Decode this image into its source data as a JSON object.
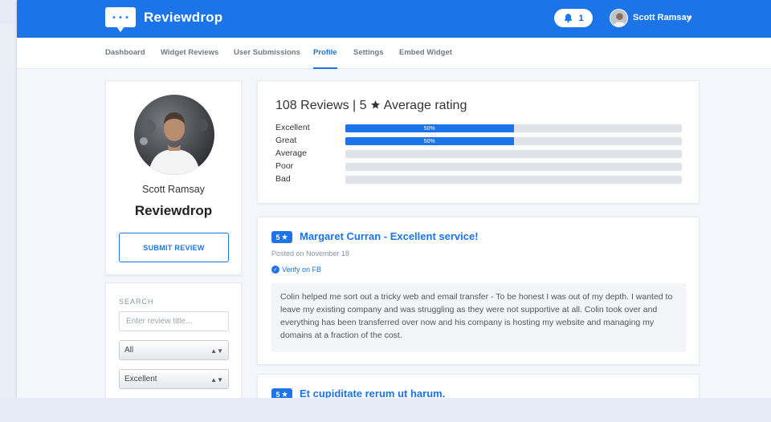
{
  "header": {
    "brand": "Reviewdrop",
    "notification_count": "1",
    "user_name": "Scott Ramsay",
    "caret": "▾"
  },
  "nav": {
    "tabs": [
      {
        "label": "Dashboard"
      },
      {
        "label": "Widget Reviews"
      },
      {
        "label": "User Submissions"
      },
      {
        "label": "Profile",
        "active": true
      },
      {
        "label": "Settings"
      },
      {
        "label": "Embed Widget"
      }
    ]
  },
  "profile": {
    "name": "Scott Ramsay",
    "title": "Reviewdrop",
    "submit_label": "SUBMIT REVIEW"
  },
  "filters": {
    "search_label": "SEARCH",
    "search_placeholder": "Enter review title...",
    "select1_value": "All",
    "select2_value": "Excellent",
    "select_arrow": "▲▼"
  },
  "summary": {
    "heading_prefix": "108 Reviews | 5",
    "heading_suffix": "Average rating",
    "rows": [
      {
        "label": "Excellent",
        "percent": 50,
        "text": "50%"
      },
      {
        "label": "Great",
        "percent": 50,
        "text": "50%"
      },
      {
        "label": "Average",
        "percent": 0,
        "text": ""
      },
      {
        "label": "Poor",
        "percent": 0,
        "text": ""
      },
      {
        "label": "Bad",
        "percent": 0,
        "text": ""
      }
    ]
  },
  "reviews": [
    {
      "rating": "5",
      "title": "Margaret Curran - Excellent service!",
      "posted": "Posted on November 18",
      "verify": "Verify on FB",
      "body": "Colin helped me sort out a tricky web and email transfer - To be honest I was out of my depth. I wanted to leave my existing company and was struggling as they were not supportive at all. Colin took over and everything has been transferred over now and his company is hosting my website and managing my domains at a fraction of the cost."
    },
    {
      "rating": "5",
      "title": "Et cupiditate rerum ut harum."
    }
  ],
  "colors": {
    "brand_blue": "#1b74e8",
    "page_bg": "#f3f6fa",
    "bar_track": "#dfe2e6"
  }
}
